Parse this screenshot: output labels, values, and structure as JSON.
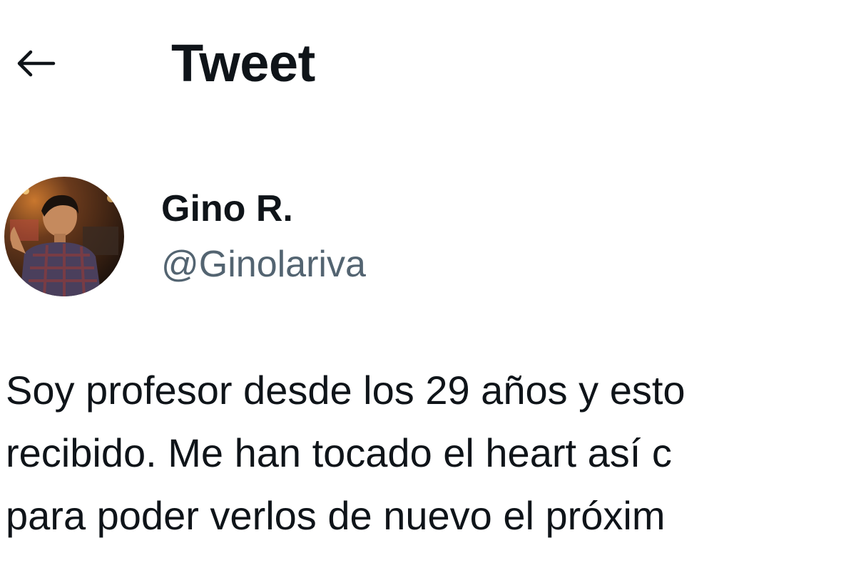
{
  "header": {
    "back_icon": "back-arrow-icon",
    "title": "Tweet"
  },
  "author": {
    "display_name": "Gino R.",
    "handle": "@Ginolariva"
  },
  "tweet": {
    "lines": [
      "Soy profesor desde los 29 años y esto",
      "recibido. Me han tocado el heart así c",
      "para poder verlos de nuevo el próxim"
    ]
  },
  "colors": {
    "text_primary": "#0f1419",
    "text_secondary": "#536471",
    "background": "#ffffff"
  }
}
